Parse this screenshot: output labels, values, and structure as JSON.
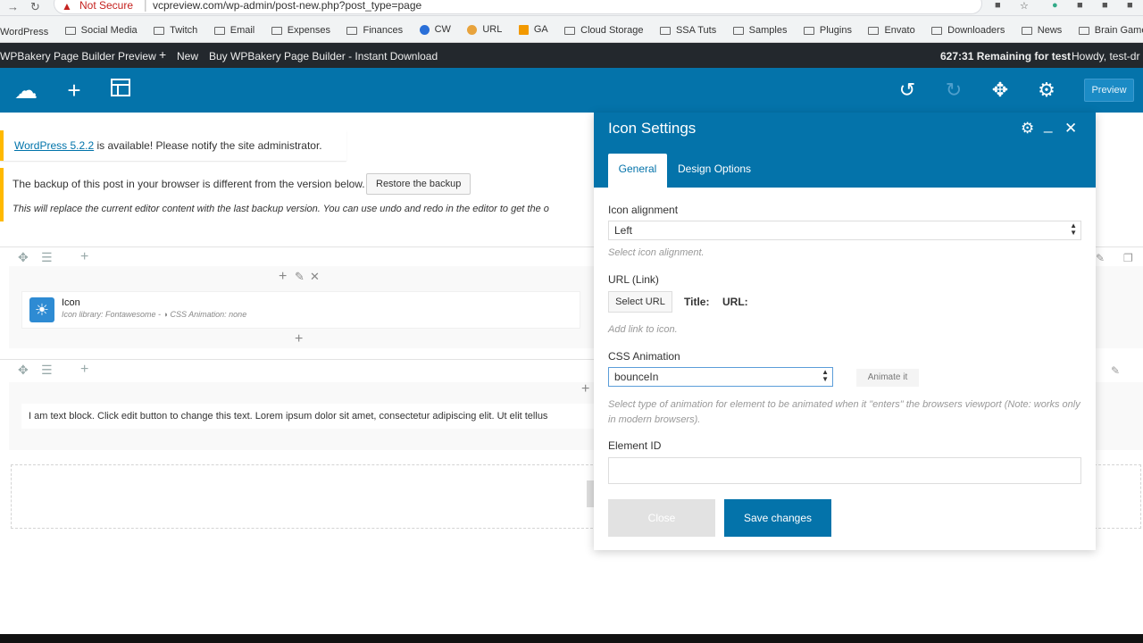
{
  "browser": {
    "security_label": "Not Secure",
    "url": "vcpreview.com/wp-admin/post-new.php?post_type=page",
    "bookmarks": [
      "WordPress",
      "Social Media",
      "Twitch",
      "Email",
      "Expenses",
      "Finances",
      "CW",
      "URL",
      "GA",
      "Cloud Storage",
      "SSA Tuts",
      "Samples",
      "Plugins",
      "Envato",
      "Downloaders",
      "News",
      "Brain Games"
    ]
  },
  "adminbar": {
    "site": "WPBakery Page Builder Preview",
    "new_label": "New",
    "buy_label": "Buy WPBakery Page Builder - Instant Download",
    "timer": "627:31 Remaining for test",
    "howdy": "Howdy, test-dr"
  },
  "vcbar": {
    "preview_label": "Preview"
  },
  "notice_update": {
    "link": "WordPress 5.2.2",
    "text": " is available! Please notify the site administrator."
  },
  "notice_backup": {
    "text": "The backup of this post in your browser is different from the version below.",
    "button": "Restore the backup",
    "detail": "This will replace the current editor content with the last backup version. You can use undo and redo in the editor to get the o"
  },
  "icon_element": {
    "name": "Icon",
    "meta": "Icon library: Fontawesome - ◑ CSS Animation: none"
  },
  "text_block": {
    "text": "I am text block. Click edit button to change this text. Lorem ipsum dolor sit amet, consectetur adipiscing elit. Ut elit tellus"
  },
  "modal": {
    "title": "Icon Settings",
    "tabs": [
      "General",
      "Design Options"
    ],
    "icon_alignment_label": "Icon alignment",
    "icon_alignment_value": "Left",
    "icon_alignment_help": "Select icon alignment.",
    "url_label": "URL (Link)",
    "select_url": "Select URL",
    "title_label": "Title:",
    "url_field_label": "URL:",
    "url_help": "Add link to icon.",
    "css_animation_label": "CSS Animation",
    "css_animation_value": "bounceIn",
    "animate_button": "Animate it",
    "css_animation_help": "Select type of animation for element to be animated when it \"enters\" the browsers viewport (Note: works only in modern browsers).",
    "element_id_label": "Element ID",
    "close_button": "Close",
    "save_button": "Save changes"
  }
}
